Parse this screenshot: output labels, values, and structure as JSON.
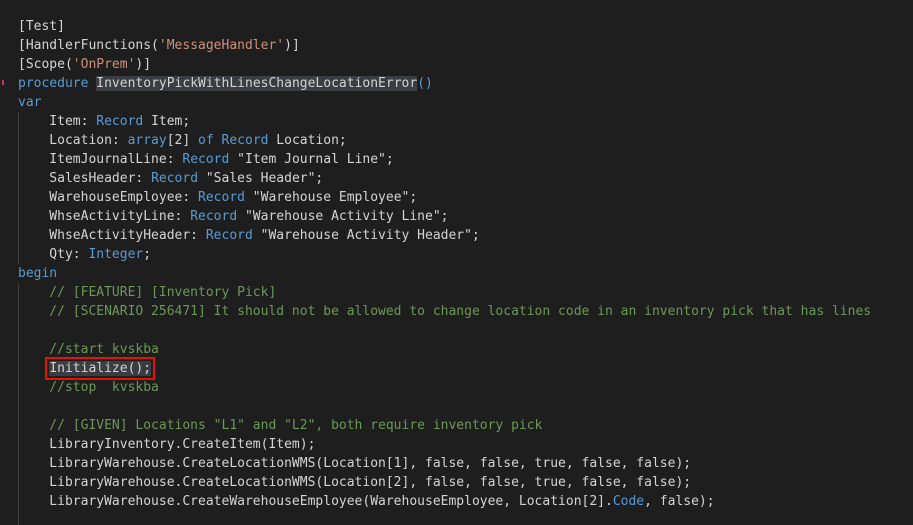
{
  "code_lines": [
    [
      {
        "t": "[Test]"
      }
    ],
    [
      {
        "t": "[HandlerFunctions("
      },
      {
        "t": "'MessageHandler'",
        "c": "str"
      },
      {
        "t": ")]"
      }
    ],
    [
      {
        "t": "[Scope("
      },
      {
        "t": "'OnPrem'",
        "c": "str"
      },
      {
        "t": ")]"
      }
    ],
    [
      {
        "t": "procedure ",
        "c": "kw"
      },
      {
        "t": "InventoryPickWithLinesChangeLocationError",
        "c": "hl"
      },
      {
        "t": "()",
        "c": "kw"
      }
    ],
    [
      {
        "t": "var",
        "c": "kw"
      }
    ],
    [
      {
        "t": "    Item: "
      },
      {
        "t": "Record",
        "c": "kw"
      },
      {
        "t": " Item;"
      }
    ],
    [
      {
        "t": "    Location: "
      },
      {
        "t": "array",
        "c": "kw"
      },
      {
        "t": "[2] "
      },
      {
        "t": "of",
        "c": "kw"
      },
      {
        "t": " "
      },
      {
        "t": "Record",
        "c": "kw"
      },
      {
        "t": " Location;"
      }
    ],
    [
      {
        "t": "    ItemJournalLine: "
      },
      {
        "t": "Record",
        "c": "kw"
      },
      {
        "t": " \"Item Journal Line\";"
      }
    ],
    [
      {
        "t": "    SalesHeader: "
      },
      {
        "t": "Record",
        "c": "kw"
      },
      {
        "t": " \"Sales Header\";"
      }
    ],
    [
      {
        "t": "    WarehouseEmployee: "
      },
      {
        "t": "Record",
        "c": "kw"
      },
      {
        "t": " \"Warehouse Employee\";"
      }
    ],
    [
      {
        "t": "    WhseActivityLine: "
      },
      {
        "t": "Record",
        "c": "kw"
      },
      {
        "t": " \"Warehouse Activity Line\";"
      }
    ],
    [
      {
        "t": "    WhseActivityHeader: "
      },
      {
        "t": "Record",
        "c": "kw"
      },
      {
        "t": " \"Warehouse Activity Header\";"
      }
    ],
    [
      {
        "t": "    Qty: "
      },
      {
        "t": "Integer",
        "c": "kw"
      },
      {
        "t": ";"
      }
    ],
    [
      {
        "t": "begin",
        "c": "kw"
      }
    ],
    [
      {
        "t": "    // [FEATURE] [Inventory Pick]",
        "c": "cmt"
      }
    ],
    [
      {
        "t": "    // [SCENARIO 256471] It should not be allowed to change location code in an inventory pick that has lines",
        "c": "cmt"
      }
    ],
    [
      {
        "t": ""
      }
    ],
    [
      {
        "t": "    //start kvskba",
        "c": "cmt"
      }
    ],
    [
      {
        "t": "    "
      },
      {
        "t": "Initialize();",
        "c": "boxed"
      }
    ],
    [
      {
        "t": "    //stop  kvskba",
        "c": "cmt"
      }
    ],
    [
      {
        "t": ""
      }
    ],
    [
      {
        "t": "    // [GIVEN] Locations \"L1\" and \"L2\", both require inventory pick",
        "c": "cmt"
      }
    ],
    [
      {
        "t": "    LibraryInventory.CreateItem(Item);"
      }
    ],
    [
      {
        "t": "    LibraryWarehouse.CreateLocationWMS(Location[1], false, false, true, false, false);"
      }
    ],
    [
      {
        "t": "    LibraryWarehouse.CreateLocationWMS(Location[2], false, false, true, false, false);"
      }
    ],
    [
      {
        "t": "    LibraryWarehouse.CreateWarehouseEmployee(WarehouseEmployee, Location[2]."
      },
      {
        "t": "Code",
        "c": "kw"
      },
      {
        "t": ", false);"
      }
    ]
  ]
}
